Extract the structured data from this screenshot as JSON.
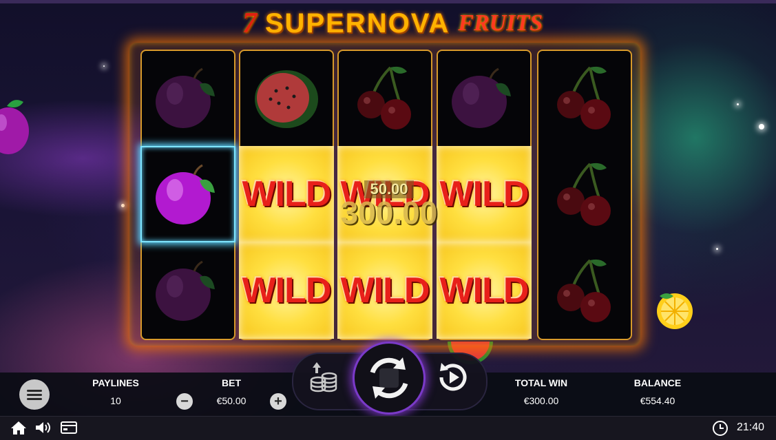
{
  "game": {
    "title_num": "7",
    "title_main": "SUPERNOVA",
    "title_sub": "FRUITS"
  },
  "reels": [
    [
      "plum",
      "plum",
      "plum"
    ],
    [
      "watermelon",
      "wild",
      "wild"
    ],
    [
      "cherry",
      "wild",
      "wild"
    ],
    [
      "plum",
      "wild",
      "wild"
    ],
    [
      "cherry",
      "cherry",
      "cherry"
    ]
  ],
  "wild_label": "WILD",
  "win": {
    "line_amount": "50.00",
    "total_amount": "300.00"
  },
  "controls": {
    "paylines_label": "PAYLINES",
    "paylines_value": "10",
    "bet_label": "BET",
    "bet_value": "€50.00",
    "bet_minus": "−",
    "bet_plus": "+",
    "total_win_label": "TOTAL WIN",
    "total_win_value": "€300.00",
    "balance_label": "BALANCE",
    "balance_value": "€554.40"
  },
  "system": {
    "time": "21:40",
    "icons": [
      "home-icon",
      "sound-icon",
      "paytable-icon",
      "clock-icon"
    ]
  },
  "colors": {
    "wild_bg": "#ffdf40",
    "wild_text": "#e8201a",
    "frame_glow": "#ff7800",
    "spin_ring": "#7a3ac8",
    "win_highlight": "#5fd6ff"
  }
}
